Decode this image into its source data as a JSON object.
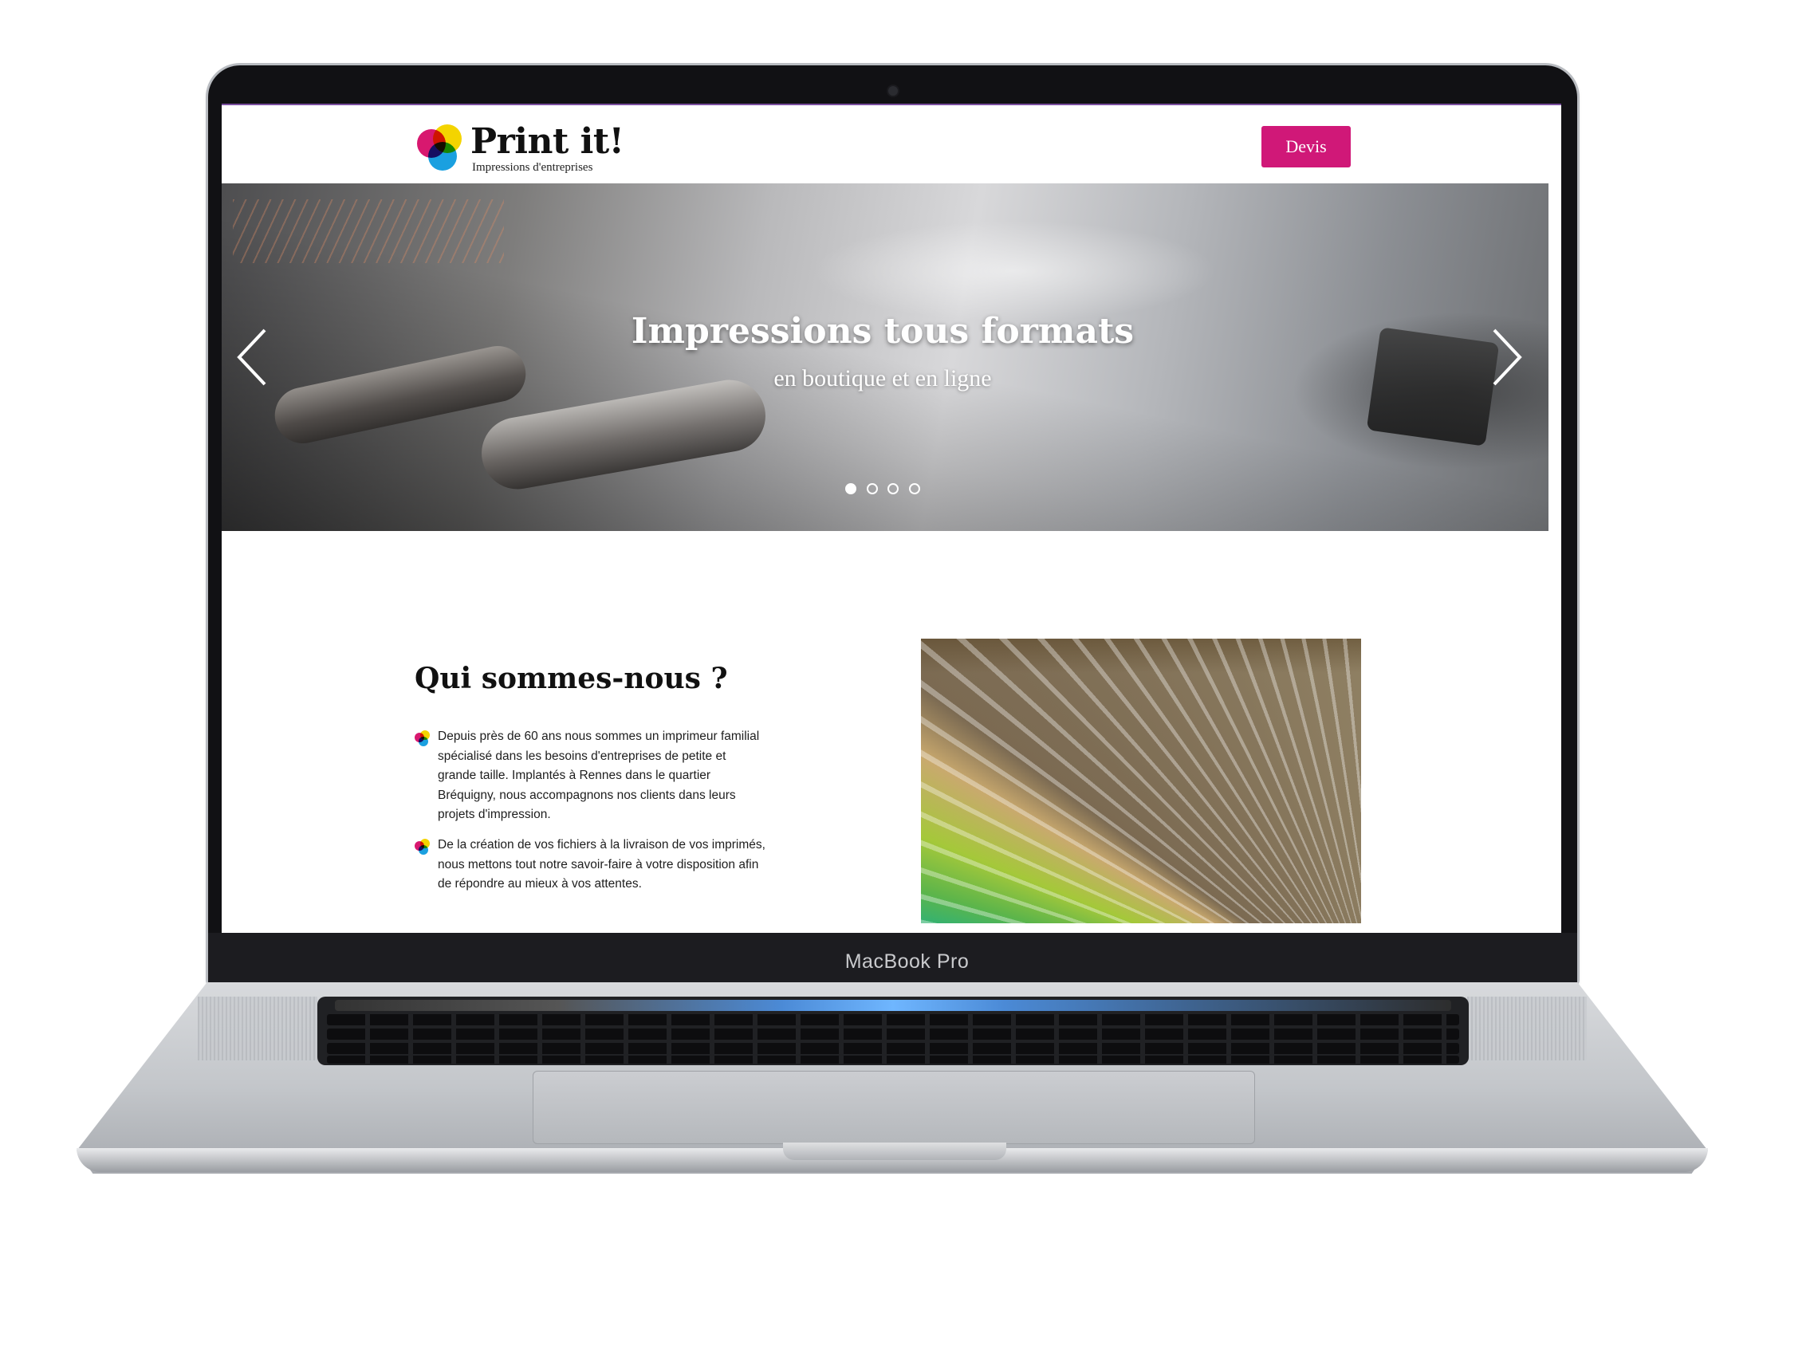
{
  "device": {
    "label": "MacBook Pro"
  },
  "header": {
    "logo_title": "Print it!",
    "logo_subtitle": "Impressions d'entreprises",
    "cta_label": "Devis",
    "accent_color": "#d01878"
  },
  "hero": {
    "title": "Impressions tous formats",
    "subtitle": "en boutique et en ligne",
    "slide_count": 4,
    "active_slide": 1,
    "prev_icon": "chevron-left-icon",
    "next_icon": "chevron-right-icon"
  },
  "about": {
    "title": "Qui sommes-nous ?",
    "paragraphs": [
      "Depuis près de 60 ans nous sommes un imprimeur familial spécialisé dans les besoins d'entreprises de petite et grande taille. Implantés à Rennes dans le quartier Bréquigny, nous accompagnons nos clients dans leurs projets d'impression.",
      "De la création de vos fichiers à la livraison de vos imprimés, nous mettons tout notre savoir-faire à votre disposition afin de répondre au mieux à vos attentes."
    ],
    "bullet_icon": "cmyk-dots-icon"
  }
}
